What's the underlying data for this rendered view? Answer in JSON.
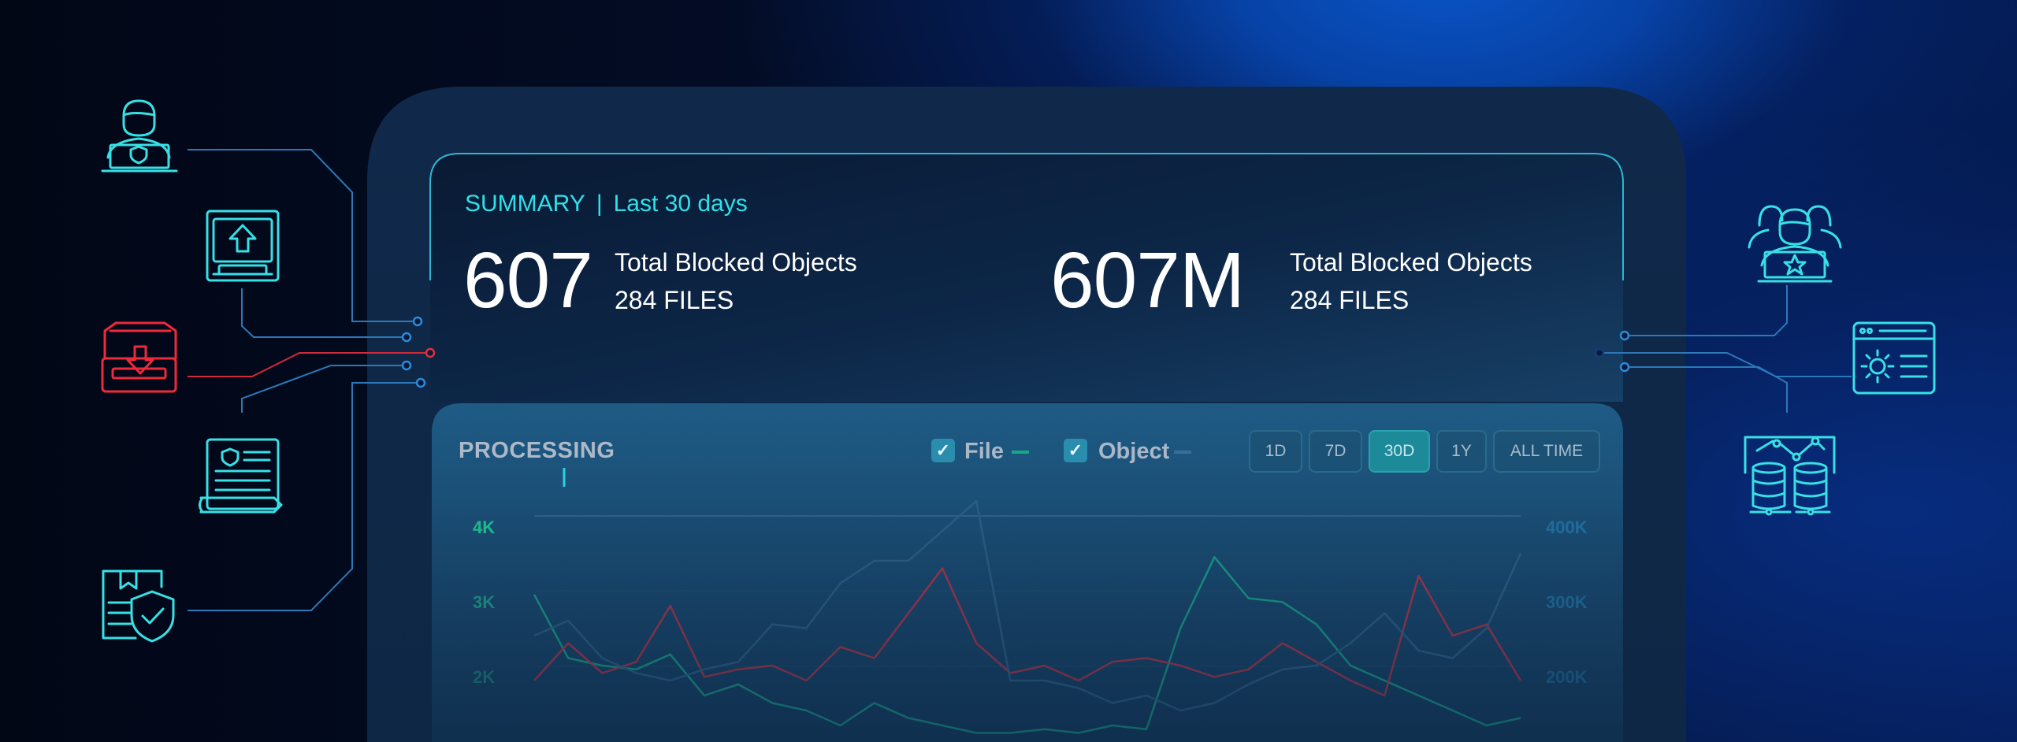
{
  "summary": {
    "heading": "SUMMARY",
    "separator": "|",
    "period": "Last 30 days",
    "stats": [
      {
        "value": "607",
        "label": "Total Blocked Objects",
        "sub": "284 FILES"
      },
      {
        "value": "607M",
        "label": "Total Blocked Objects",
        "sub": "284 FILES"
      }
    ]
  },
  "processing": {
    "title": "PROCESSING",
    "legend": [
      {
        "label": "File",
        "checked": true,
        "color": "#17a888"
      },
      {
        "label": "Object",
        "checked": true,
        "color": "#3a6f95"
      }
    ],
    "ranges": [
      "1D",
      "7D",
      "30D",
      "1Y",
      "ALL TIME"
    ],
    "active_range": "30D"
  },
  "chart_data": {
    "type": "line",
    "left_axis_ticks": [
      "4K",
      "3K",
      "2K"
    ],
    "right_axis_ticks": [
      "400K",
      "300K",
      "200K"
    ],
    "ylim_left": [
      1000,
      4000
    ],
    "ylim_right": [
      100000,
      400000
    ],
    "x": [
      1,
      2,
      3,
      4,
      5,
      6,
      7,
      8,
      9,
      10,
      11,
      12,
      13,
      14,
      15,
      16,
      17,
      18,
      19,
      20,
      21,
      22,
      23,
      24,
      25,
      26,
      27,
      28,
      29,
      30
    ],
    "series": [
      {
        "color": "#17a888",
        "axis": "left",
        "values": [
          2950,
          2100,
          2000,
          1950,
          2150,
          1600,
          1750,
          1500,
          1400,
          1200,
          1500,
          1300,
          1200,
          1100,
          1100,
          1150,
          1100,
          1200,
          1150,
          2500,
          3450,
          2900,
          2850,
          2550,
          2000,
          1800,
          1600,
          1400,
          1200,
          1300
        ]
      },
      {
        "color": "#c23040",
        "axis": "left",
        "values": [
          1800,
          2300,
          1900,
          2050,
          2800,
          1850,
          1950,
          2000,
          1800,
          2250,
          2100,
          2700,
          3300,
          2300,
          1900,
          2000,
          1800,
          2050,
          2100,
          2000,
          1850,
          1950,
          2300,
          2050,
          1800,
          1600,
          3200,
          2400,
          2550,
          1800
        ]
      },
      {
        "color": "#2f5f86",
        "axis": "right",
        "values": [
          240000,
          260000,
          210000,
          190000,
          180000,
          195000,
          205000,
          255000,
          250000,
          310000,
          340000,
          340000,
          380000,
          420000,
          180000,
          180000,
          170000,
          150000,
          160000,
          140000,
          150000,
          175000,
          195000,
          200000,
          230000,
          270000,
          220000,
          210000,
          250000,
          350000
        ]
      }
    ]
  }
}
